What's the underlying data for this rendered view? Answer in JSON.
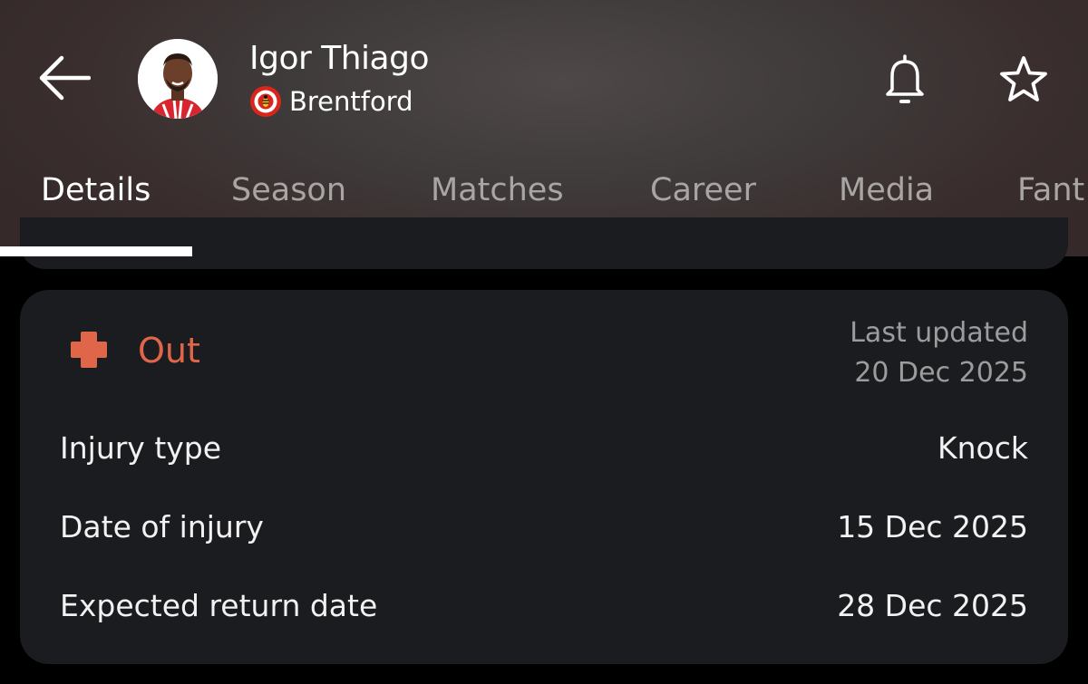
{
  "header": {
    "player_name": "Igor Thiago",
    "club_name": "Brentford"
  },
  "icons": {
    "back": "arrow-left-icon",
    "notifications": "bell-icon",
    "favorite": "star-icon",
    "status": "medical-cross-icon"
  },
  "tabs": [
    {
      "label": "Details",
      "active": true
    },
    {
      "label": "Season",
      "active": false
    },
    {
      "label": "Matches",
      "active": false
    },
    {
      "label": "Career",
      "active": false
    },
    {
      "label": "Media",
      "active": false
    },
    {
      "label": "Fant",
      "active": false
    }
  ],
  "injury": {
    "status": "Out",
    "status_color": "#e0664a",
    "last_updated_label": "Last updated",
    "last_updated_date": "20 Dec 2025",
    "rows": [
      {
        "label": "Injury type",
        "value": "Knock"
      },
      {
        "label": "Date of injury",
        "value": "15 Dec 2025"
      },
      {
        "label": "Expected return date",
        "value": "28 Dec 2025"
      }
    ]
  },
  "colors": {
    "card_bg": "#1b1c1f",
    "accent": "#e0664a",
    "inactive_tab": "#a9a5a4"
  }
}
